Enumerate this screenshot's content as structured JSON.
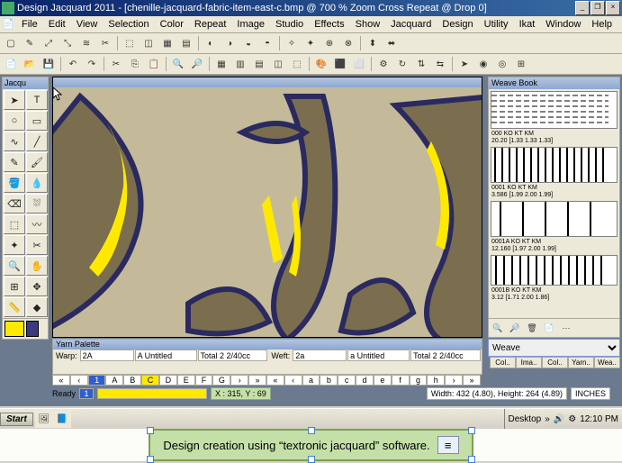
{
  "title": "Design Jacquard 2011 - [chenille-jacquard-fabric-item-east-c.bmp @ 700 % Zoom Cross Repeat @ Drop 0]",
  "menu": [
    "File",
    "Edit",
    "View",
    "Selection",
    "Color",
    "Repeat",
    "Image",
    "Studio",
    "Effects",
    "Show",
    "Jacquard",
    "Design",
    "Utility",
    "Ikat",
    "Window",
    "Help"
  ],
  "toolbox_header": "Jacqu",
  "canvas_header": "",
  "swatches": {
    "current": "#ffe900",
    "alt": "#3a3a80"
  },
  "weavebook": {
    "title": "Weave Book",
    "patterns": [
      {
        "id": "000 KO KT KM",
        "dim": "20.20 [1.33 1.33 1.33]"
      },
      {
        "id": "0001 KO KT KM",
        "dim": "3.586 [1.99 2.00 1.99]"
      },
      {
        "id": "0001A KO KT KM",
        "dim": "12.160 [1.97 2.00 1.99]"
      },
      {
        "id": "0001B KO KT KM",
        "dim": "3.12 [1.71 2.00 1.86]"
      }
    ],
    "combo": "Weave"
  },
  "minitabs": [
    "Col..",
    "Ima..",
    "Col..",
    "Yarn..",
    "Wea.."
  ],
  "yarn": {
    "title": "Yarn Palette",
    "warp_label": "Warp:",
    "warp_val": "2A",
    "warp_name": "A  Untitled",
    "warp_total": "Total 2  2/40cc",
    "weft_label": "Weft:",
    "weft_val": "2a",
    "weft_name": "a  Untitled",
    "weft_total": "Total 2  2/40cc"
  },
  "ruler_top": [
    "«",
    "‹",
    "1",
    "A",
    "B",
    "C",
    "D",
    "E",
    "F",
    "G",
    "›",
    "»",
    "«",
    "‹",
    "a",
    "b",
    "c",
    "d",
    "e",
    "f",
    "g",
    "h",
    "›",
    "»"
  ],
  "coord": {
    "selected": "1",
    "xy": "X : 315, Y :",
    "sel": "69",
    "dims": "Width: 432 (4.80), Height: 264 (4.89)",
    "unit": "INCHES"
  },
  "status": "Ready",
  "taskbar": {
    "start": "Start",
    "desktop": "Desktop",
    "time": "12:10 PM"
  },
  "caption": "Design creation using “textronic jacquard” software."
}
